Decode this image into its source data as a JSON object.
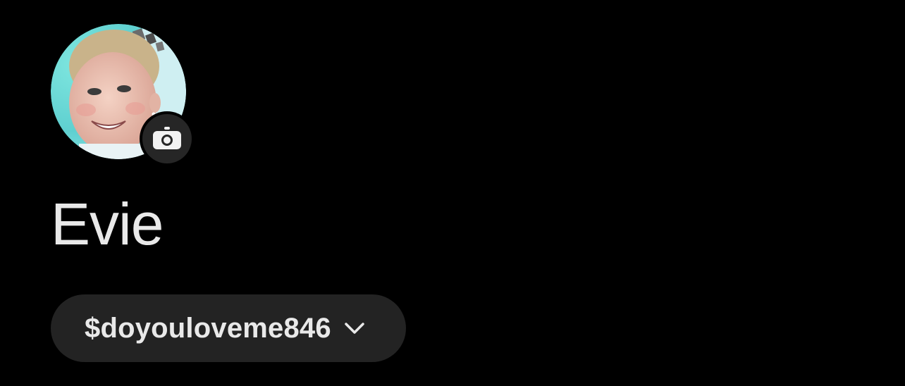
{
  "profile": {
    "display_name": "Evie",
    "cashtag": "$doyouloveme846",
    "avatar_icon": "profile-photo",
    "camera_icon": "camera-icon",
    "dropdown_icon": "chevron-down-icon"
  },
  "colors": {
    "background": "#000000",
    "text": "#e9e9e9",
    "pill": "#232323",
    "camera_badge": "#262626"
  }
}
